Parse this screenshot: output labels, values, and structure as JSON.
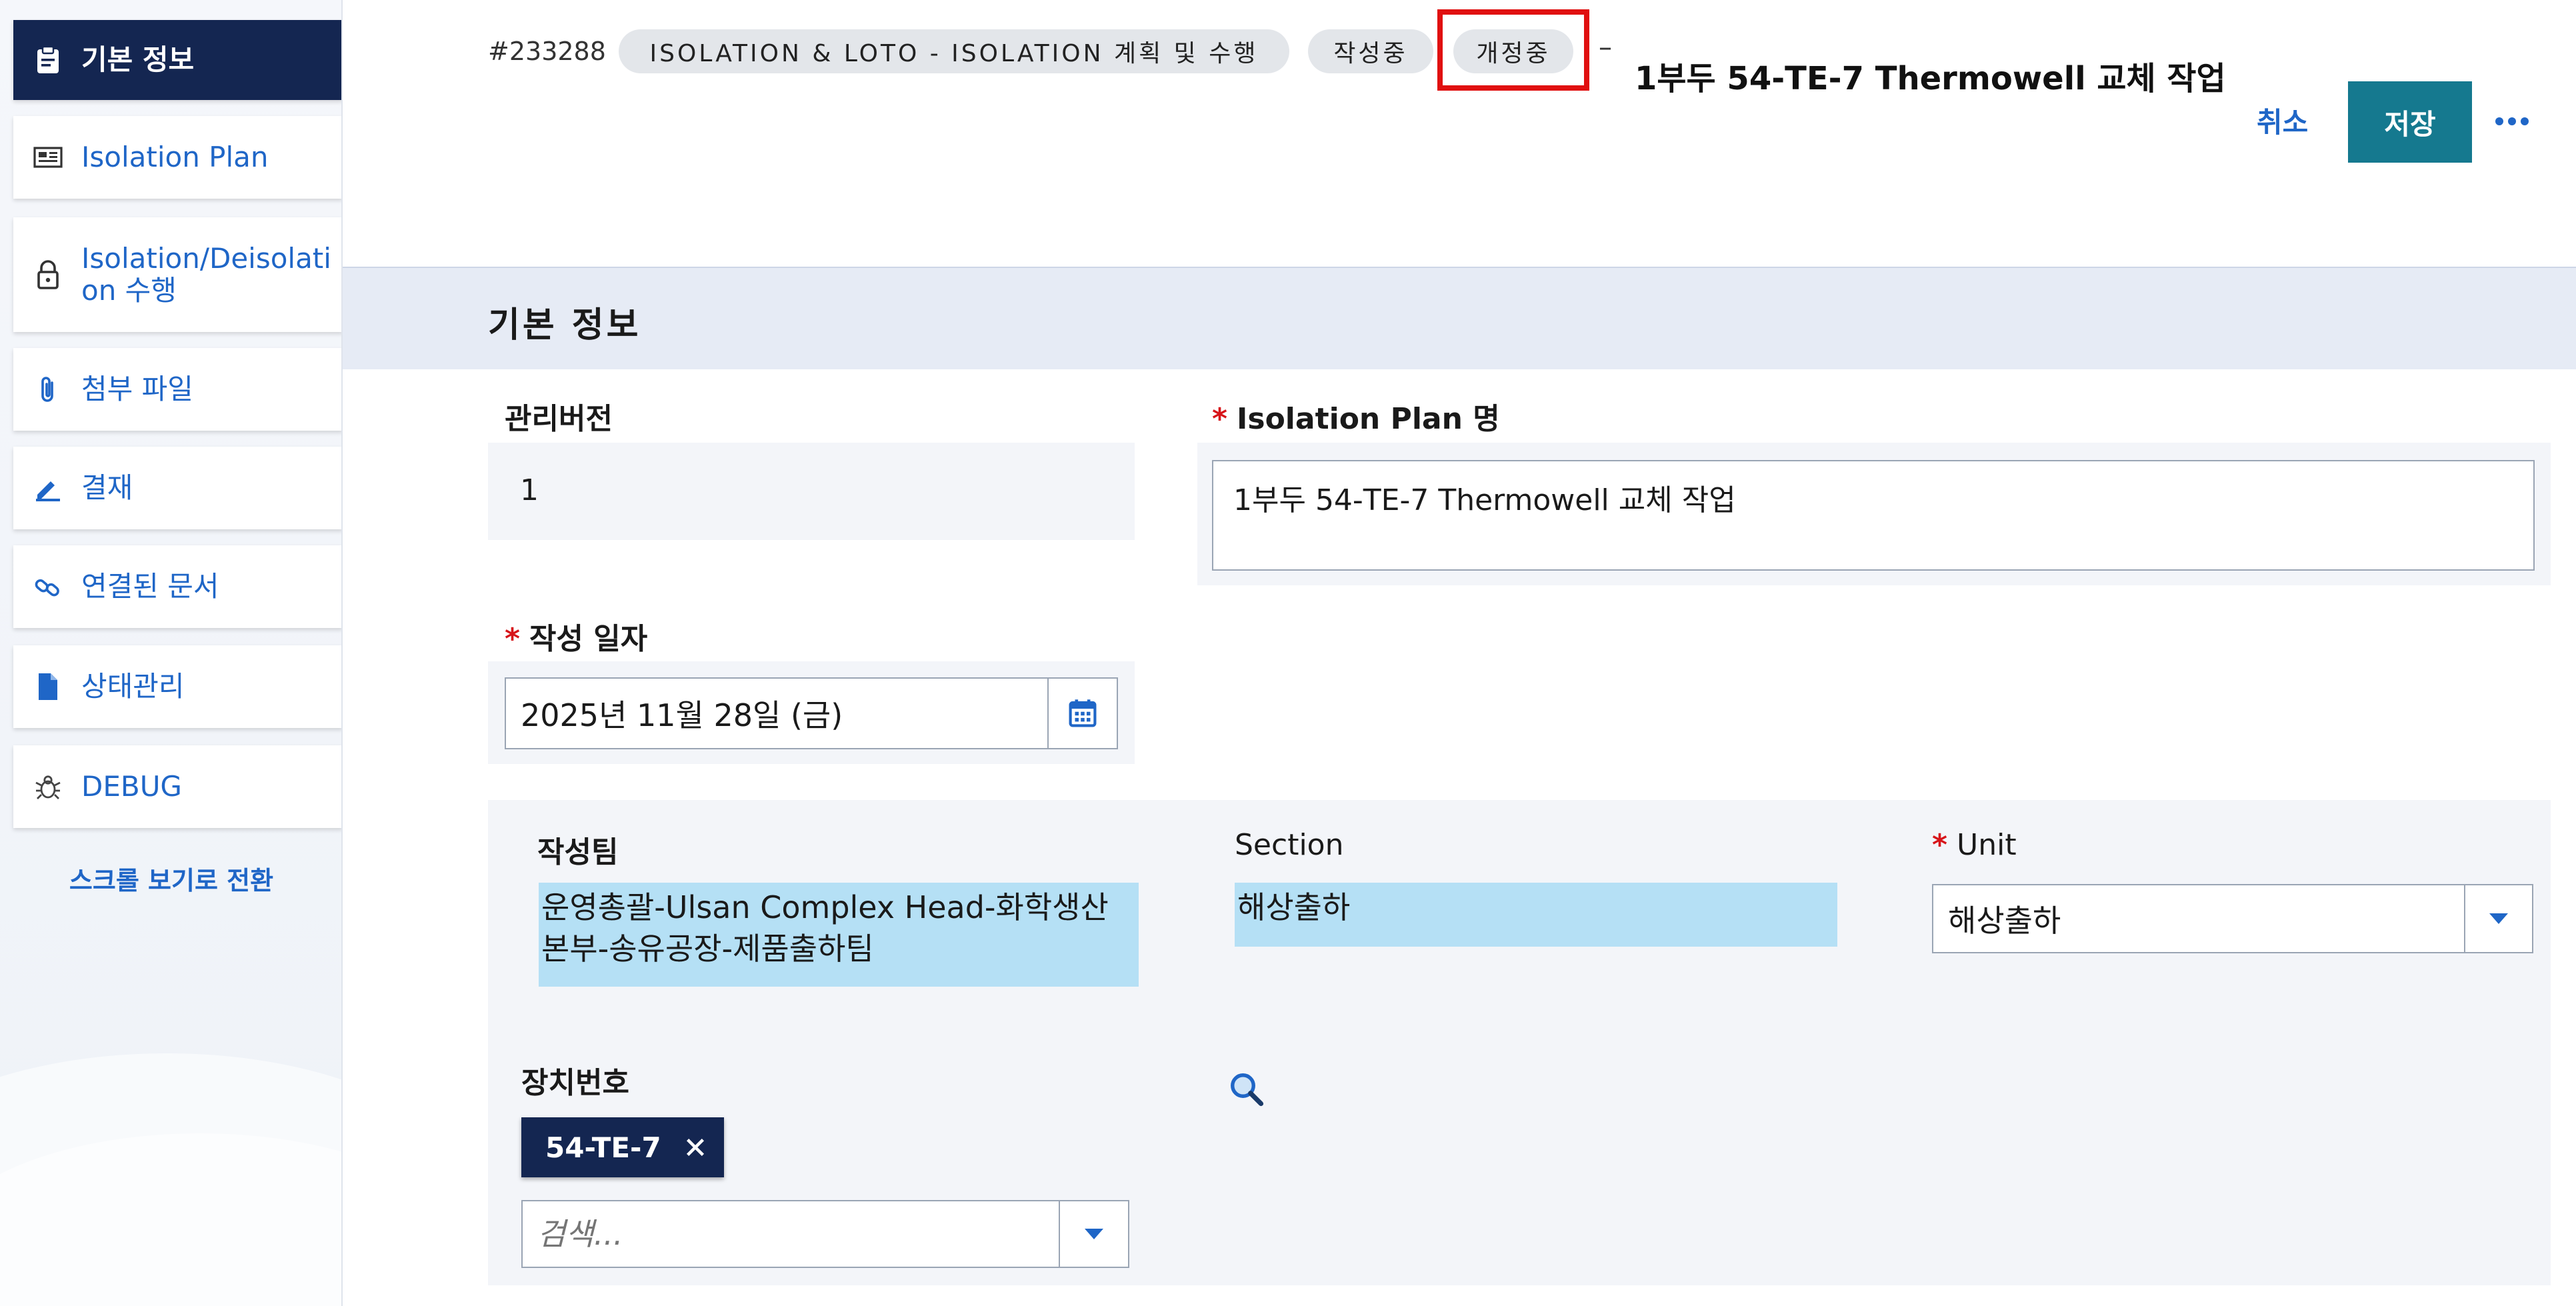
{
  "sidebar": {
    "items": [
      {
        "label": "기본 정보",
        "icon": "clipboard-icon",
        "active": true
      },
      {
        "label": "Isolation Plan",
        "icon": "plan-image-icon"
      },
      {
        "label": "Isolation/Deisolation 수행",
        "icon": "lock-icon"
      },
      {
        "label": "첨부 파일",
        "icon": "paperclip-icon"
      },
      {
        "label": "결재",
        "icon": "pen-icon"
      },
      {
        "label": "연결된 문서",
        "icon": "link-icon"
      },
      {
        "label": "상태관리",
        "icon": "document-icon"
      },
      {
        "label": "DEBUG",
        "icon": "bug-icon"
      }
    ],
    "scroll_view_link": "스크롤 보기로 전환"
  },
  "header": {
    "doc_id": "#233288",
    "category_chip": "ISOLATION & LOTO - ISOLATION 계획 및 수행",
    "status_chip": "작성중",
    "revision_chip": "개정중",
    "dash": "–",
    "title": "1부두 54-TE-7 Thermowell 교체 작업",
    "cancel_label": "취소",
    "save_label": "저장"
  },
  "section": {
    "title": "기본 정보"
  },
  "form": {
    "version_label": "관리버전",
    "version_value": "1",
    "plan_name_label": "Isolation Plan 명",
    "plan_name_value": "1부두 54-TE-7 Thermowell 교체 작업",
    "date_label": "작성 일자",
    "date_value": "2025년 11월 28일 (금)",
    "team_label": "작성팀",
    "team_value": "운영총괄-Ulsan Complex Head-화학생산본부-송유공장-제품출하팀",
    "section_label": "Section",
    "section_value": "해상출하",
    "unit_label": "Unit",
    "unit_value": "해상출하",
    "device_label": "장치번호",
    "device_tag": "54-TE-7",
    "search_placeholder": "검색..."
  },
  "colors": {
    "sidebar_active": "#142651",
    "link_blue": "#1f66c7",
    "save_button": "#15798f",
    "required_star": "#d7151a",
    "highlight_value": "#b5e0f5",
    "section_band": "#e6ebf5",
    "red_outline": "#e01010"
  }
}
